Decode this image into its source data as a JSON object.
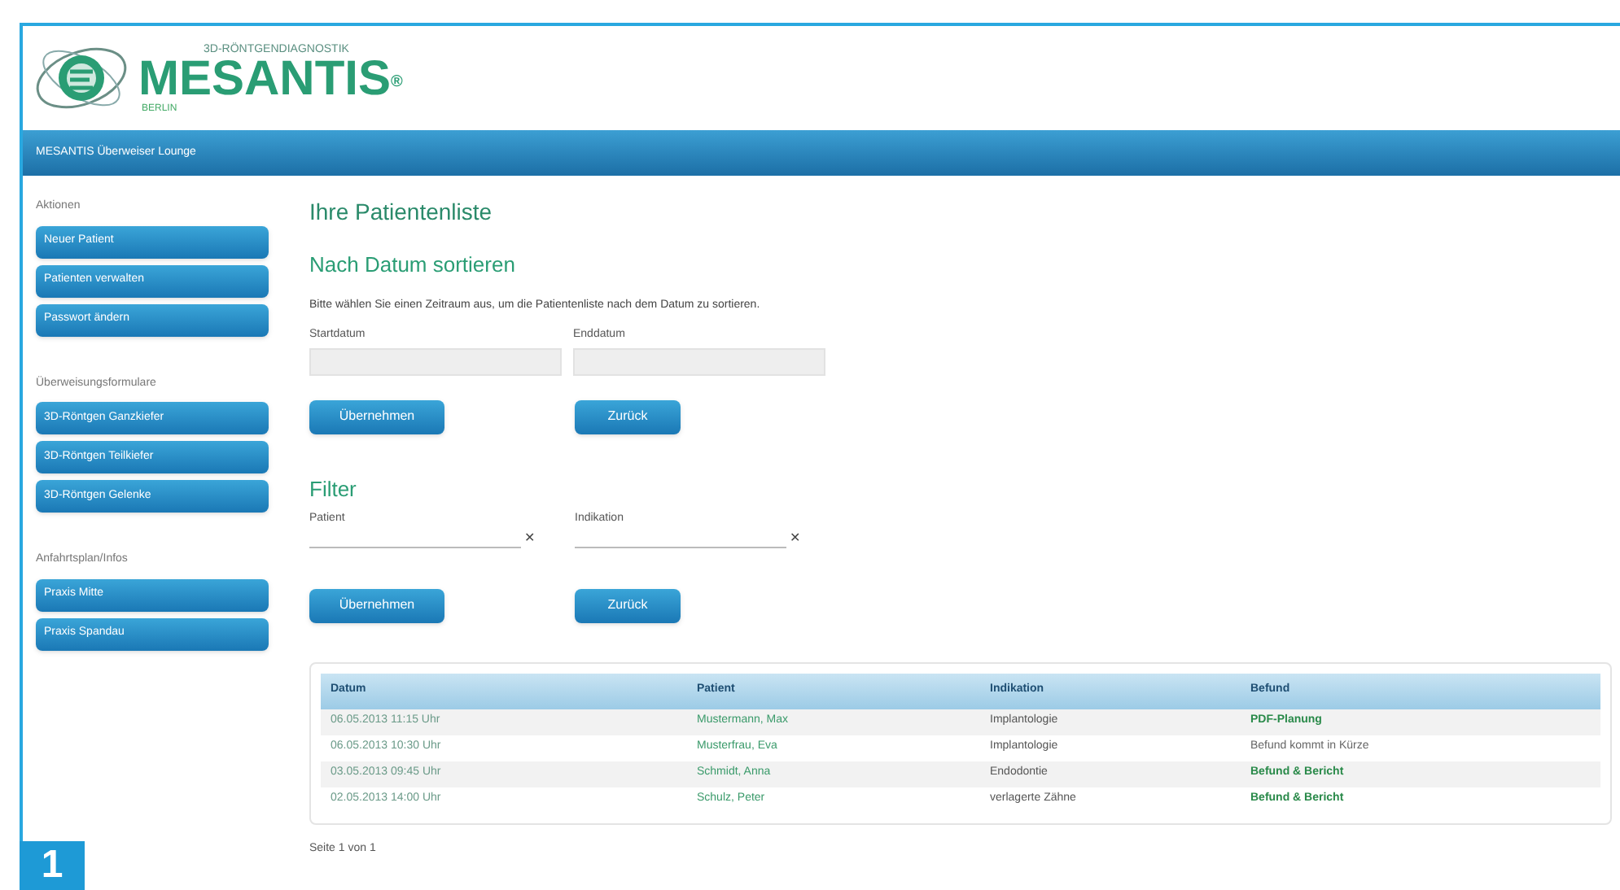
{
  "header": {
    "tagline": "3D-RÖNTGENDIAGNOSTIK",
    "brand": "MESANTIS",
    "brand_mark": "®",
    "city": "BERLIN"
  },
  "nav_bar": {
    "title": "MESANTIS Überweiser Lounge"
  },
  "sidebar": {
    "sections": [
      {
        "heading": "Aktionen",
        "items": [
          "Neuer Patient",
          "Patienten verwalten",
          "Passwort ändern"
        ]
      },
      {
        "heading": "Überweisungsformulare",
        "items": [
          "3D-Röntgen Ganzkiefer",
          "3D-Röntgen Teilkiefer",
          "3D-Röntgen Gelenke"
        ]
      },
      {
        "heading": "Anfahrtsplan/Infos",
        "items": [
          "Praxis Mitte",
          "Praxis Spandau"
        ]
      }
    ]
  },
  "content": {
    "title": "Ihre Patientenliste",
    "sort": {
      "heading": "Nach Datum sortieren",
      "hint": "Bitte wählen Sie einen Zeitraum aus, um die Patientenliste nach dem Datum zu sortieren.",
      "fields": [
        {
          "label": "Startdatum"
        },
        {
          "label": "Enddatum"
        }
      ],
      "buttons": [
        "Übernehmen",
        "Zurück"
      ]
    },
    "filter": {
      "heading": "Filter",
      "fields": [
        {
          "label": "Patient",
          "clear": "✕"
        },
        {
          "label": "Indikation",
          "clear": "✕"
        }
      ],
      "buttons": [
        "Übernehmen",
        "Zurück"
      ]
    },
    "table": {
      "columns": [
        "Datum",
        "Patient",
        "Indikation",
        "Befund"
      ],
      "rows": [
        {
          "date": "06.05.2013 11:15 Uhr",
          "patient": "Mustermann, Max",
          "indication": "Implantologie",
          "finding": "PDF-Planung",
          "kind": "link"
        },
        {
          "date": "06.05.2013 10:30 Uhr",
          "patient": "Musterfrau, Eva",
          "indication": "Implantologie",
          "finding": "Befund kommt in Kürze",
          "kind": "pending"
        },
        {
          "date": "03.05.2013 09:45 Uhr",
          "patient": "Schmidt, Anna",
          "indication": "Endodontie",
          "finding": "Befund & Bericht",
          "kind": "link"
        },
        {
          "date": "02.05.2013 14:00 Uhr",
          "patient": "Schulz, Peter",
          "indication": "verlagerte Zähne",
          "finding": "Befund & Bericht",
          "kind": "link"
        }
      ]
    },
    "pagination": "Seite 1 von 1"
  },
  "figure_label": "1"
}
